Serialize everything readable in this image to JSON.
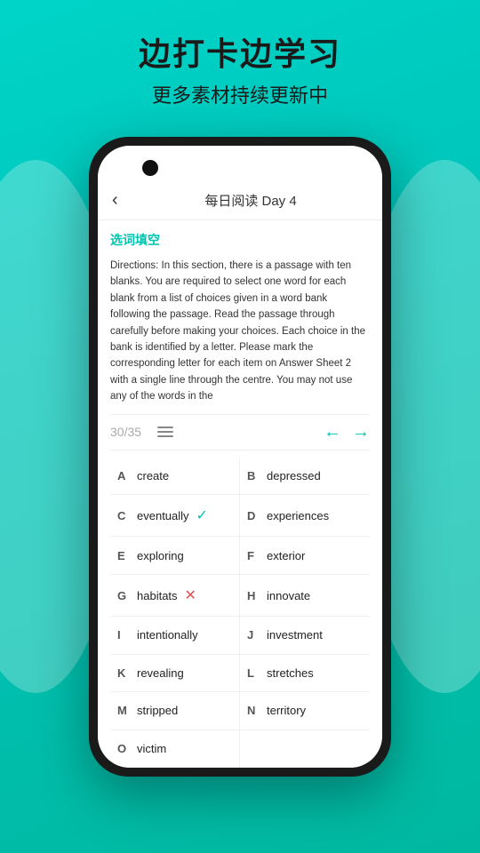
{
  "header": {
    "title": "边打卡边学习",
    "subtitle": "更多素材持续更新中"
  },
  "phone": {
    "camera_label": "camera",
    "nav": {
      "back_icon": "‹",
      "title": "每日阅读 Day 4"
    },
    "section_label": "选词填空",
    "passage": "Directions: In this section, there is a passage with ten blanks. You are required to select one word for each blank from a list of choices given in a word bank following the passage. Read the passage through carefully before making your choices. Each choice in the bank is identified by a letter. Please mark the corresponding letter for each item on Answer Sheet 2 with a single line through the centre. You may not use any of the words in the",
    "progress": {
      "current": "30",
      "total": "/35"
    },
    "words": [
      {
        "letter": "A",
        "word": "create",
        "status": "none",
        "col": "left"
      },
      {
        "letter": "B",
        "word": "depressed",
        "status": "none",
        "col": "right"
      },
      {
        "letter": "C",
        "word": "eventually",
        "status": "check",
        "col": "left"
      },
      {
        "letter": "D",
        "word": "experiences",
        "status": "none",
        "col": "right"
      },
      {
        "letter": "E",
        "word": "exploring",
        "status": "none",
        "col": "left"
      },
      {
        "letter": "F",
        "word": "exterior",
        "status": "none",
        "col": "right"
      },
      {
        "letter": "G",
        "word": "habitats",
        "status": "cross",
        "col": "left"
      },
      {
        "letter": "H",
        "word": "innovate",
        "status": "none",
        "col": "right"
      },
      {
        "letter": "I",
        "word": "intentionally",
        "status": "none",
        "col": "left"
      },
      {
        "letter": "J",
        "word": "investment",
        "status": "none",
        "col": "right"
      },
      {
        "letter": "K",
        "word": "revealing",
        "status": "none",
        "col": "left"
      },
      {
        "letter": "L",
        "word": "stretches",
        "status": "none",
        "col": "right"
      },
      {
        "letter": "M",
        "word": "stripped",
        "status": "none",
        "col": "left"
      },
      {
        "letter": "N",
        "word": "territory",
        "status": "none",
        "col": "right"
      },
      {
        "letter": "O",
        "word": "victim",
        "status": "none",
        "col": "left"
      },
      {
        "letter": "",
        "word": "",
        "status": "none",
        "col": "right"
      }
    ]
  }
}
